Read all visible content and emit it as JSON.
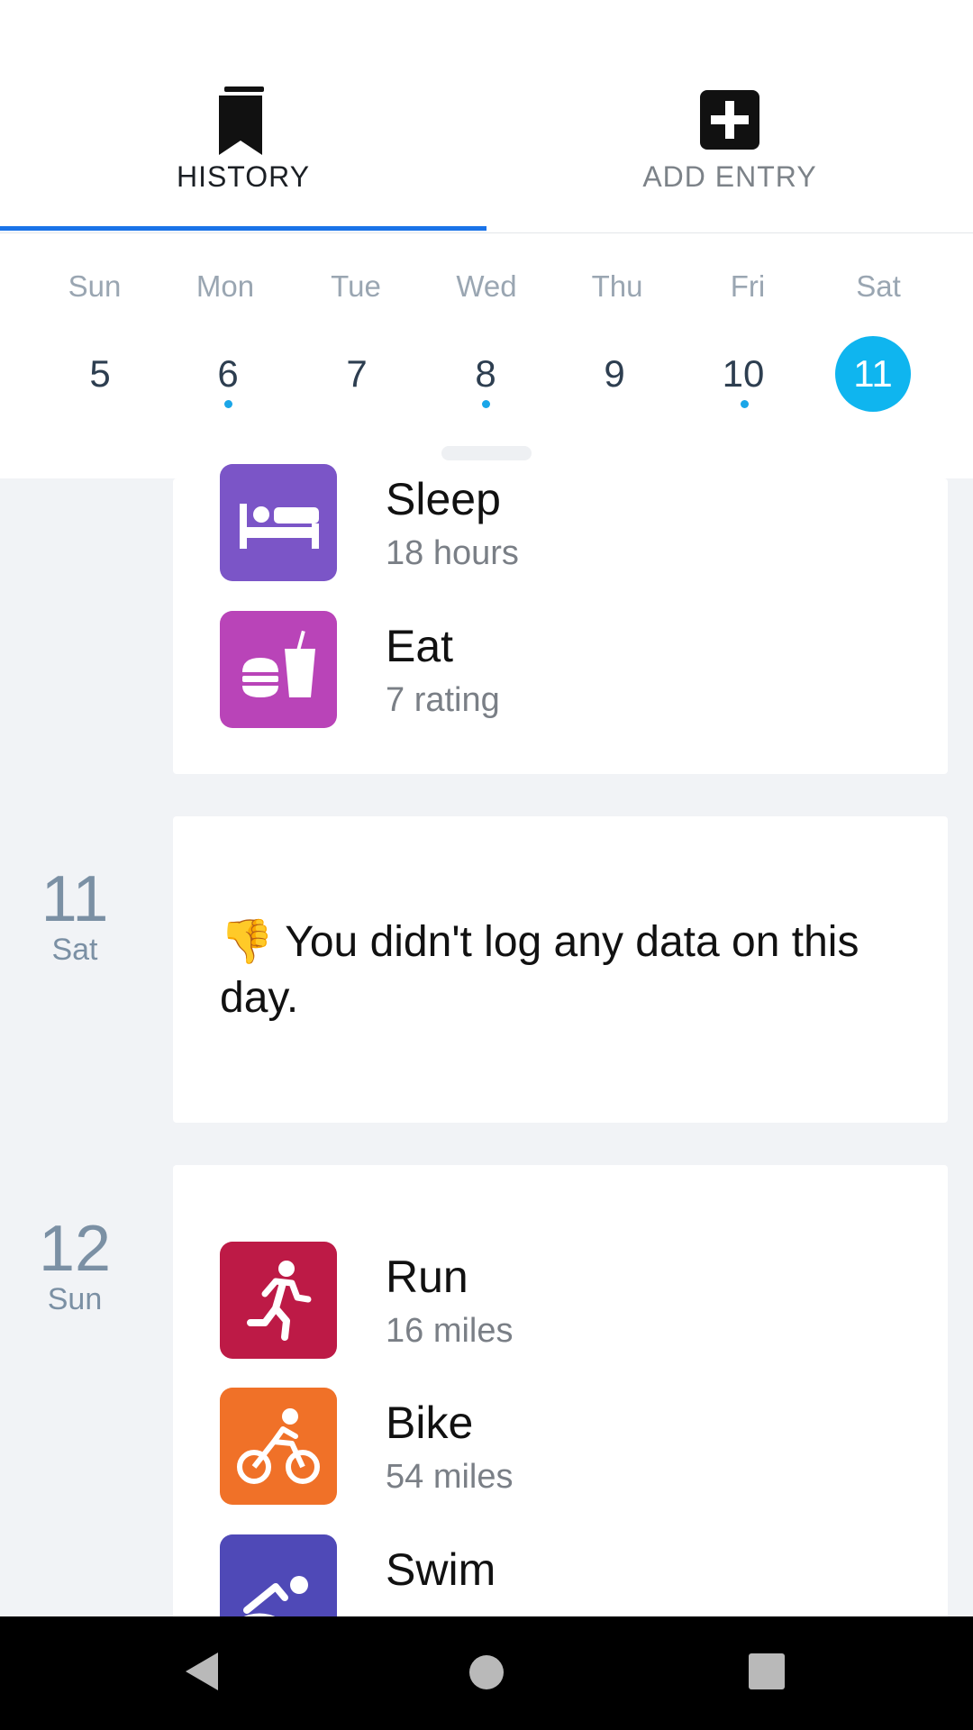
{
  "tabs": {
    "history": {
      "label": "HISTORY",
      "icon": "bookmark-icon",
      "selected": true
    },
    "add_entry": {
      "label": "ADD ENTRY",
      "icon": "plus-square-icon",
      "selected": false
    }
  },
  "week": {
    "days": [
      {
        "name": "Sun",
        "num": "5",
        "has_data": false
      },
      {
        "name": "Mon",
        "num": "6",
        "has_data": true
      },
      {
        "name": "Tue",
        "num": "7",
        "has_data": false
      },
      {
        "name": "Wed",
        "num": "8",
        "has_data": true
      },
      {
        "name": "Thu",
        "num": "9",
        "has_data": false
      },
      {
        "name": "Fri",
        "num": "10",
        "has_data": true
      },
      {
        "name": "Sat",
        "num": "11",
        "has_data": false,
        "selected": true
      }
    ]
  },
  "days": [
    {
      "entries": [
        {
          "title": "Sleep",
          "subtitle": "18 hours",
          "icon": "bed-icon",
          "color": "#7b55c7"
        },
        {
          "title": "Eat",
          "subtitle": "7 rating",
          "icon": "food-drink-icon",
          "color": "#b944b8"
        }
      ]
    },
    {
      "num": "11",
      "name": "Sat",
      "no_data_emoji": "👎",
      "no_data_text": "You didn't log any data on this day."
    },
    {
      "num": "12",
      "name": "Sun",
      "entries": [
        {
          "title": "Run",
          "subtitle": "16 miles",
          "icon": "runner-icon",
          "color": "#bd1a46"
        },
        {
          "title": "Bike",
          "subtitle": "54 miles",
          "icon": "cyclist-icon",
          "color": "#f07128"
        },
        {
          "title": "Swim",
          "subtitle": "",
          "icon": "swimmer-icon",
          "color": "#4f49b7"
        }
      ]
    }
  ],
  "colors": {
    "accent": "#1a73e8",
    "selected_day": "#0fb5ef",
    "dot": "#1aa6e8"
  },
  "navbar": {
    "back": "back-icon",
    "home": "home-icon",
    "recents": "recents-icon"
  }
}
